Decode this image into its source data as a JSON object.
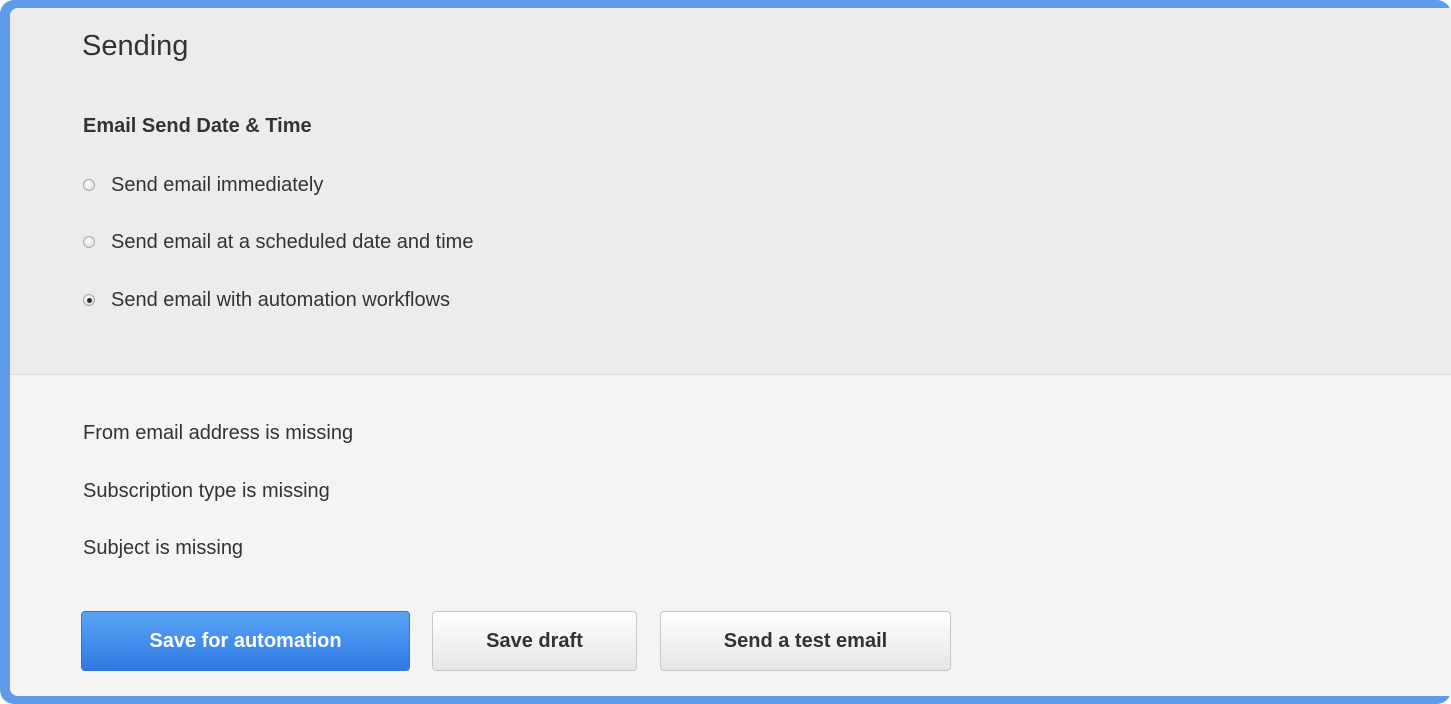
{
  "section": {
    "title": "Sending",
    "group_label": "Email Send Date & Time"
  },
  "send_options": [
    {
      "label": "Send email immediately",
      "checked": false
    },
    {
      "label": "Send email at a scheduled date and time",
      "checked": false
    },
    {
      "label": "Send email with automation workflows",
      "checked": true
    }
  ],
  "messages": [
    "From email address is missing",
    "Subscription type is missing",
    "Subject is missing"
  ],
  "buttons": {
    "primary": "Save for automation",
    "draft": "Save draft",
    "test": "Send a test email"
  },
  "colors": {
    "frame": "#5e9be8",
    "primary_button": "#2f7ae3",
    "panel_top": "#ececec",
    "panel_bottom": "#f4f4f4"
  }
}
